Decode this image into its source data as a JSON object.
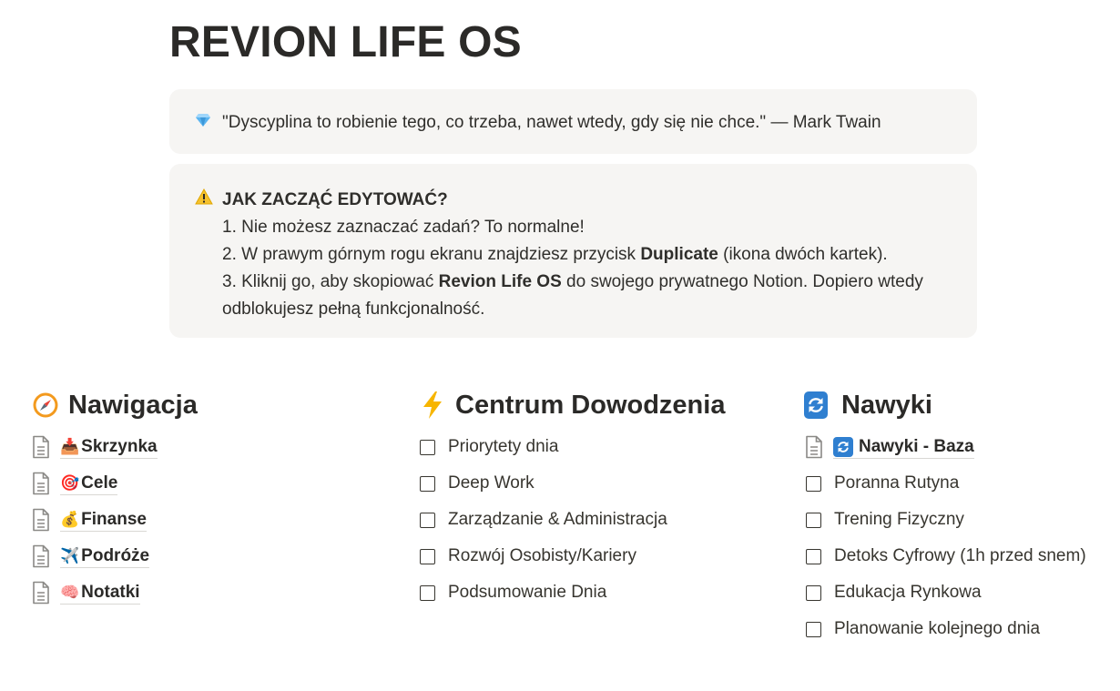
{
  "page": {
    "title": "REVION LIFE OS"
  },
  "quote_callout": {
    "icon": "gem-icon",
    "text": "\"Dyscyplina to robienie tego, co trzeba, nawet wtedy, gdy się nie chce.\" — Mark Twain"
  },
  "warning_callout": {
    "icon": "warning-icon",
    "title": "JAK ZACZĄĆ EDYTOWAĆ?",
    "line1": "1. Nie możesz zaznaczać zadań? To normalne!",
    "line2_a": "2. W prawym górnym rogu ekranu znajdziesz przycisk ",
    "line2_b": "Duplicate",
    "line2_c": " (ikona dwóch kartek).",
    "line3_a": "3. Kliknij go, aby skopiować ",
    "line3_b": "Revion Life OS",
    "line3_c": " do swojego prywatnego Notion. Dopiero wtedy odblokujesz pełną funkcjonalność."
  },
  "navigation": {
    "icon": "compass-icon",
    "title": "Nawigacja",
    "items": [
      {
        "emoji": "📥",
        "label": "Skrzynka"
      },
      {
        "emoji": "🎯",
        "label": "Cele"
      },
      {
        "emoji": "💰",
        "label": "Finanse"
      },
      {
        "emoji": "✈️",
        "label": "Podróże"
      },
      {
        "emoji": "🧠",
        "label": "Notatki"
      }
    ]
  },
  "command_center": {
    "icon": "lightning-icon",
    "title": "Centrum Dowodzenia",
    "tasks": [
      {
        "label": "Priorytety dnia",
        "checked": false
      },
      {
        "label": "Deep Work",
        "checked": false
      },
      {
        "label": "Zarządzanie & Administracja",
        "checked": false
      },
      {
        "label": "Rozwój Osobisty/Kariery",
        "checked": false
      },
      {
        "label": "Podsumowanie Dnia",
        "checked": false
      }
    ]
  },
  "habits": {
    "icon": "sync-icon",
    "title": "Nawyki",
    "db_link": {
      "label": "Nawyki - Baza"
    },
    "tasks": [
      {
        "label": "Poranna Rutyna",
        "checked": false
      },
      {
        "label": "Trening Fizyczny",
        "checked": false
      },
      {
        "label": "Detoks Cyfrowy (1h przed snem)",
        "checked": false
      },
      {
        "label": "Edukacja Rynkowa",
        "checked": false
      },
      {
        "label": "Planowanie kolejnego dnia",
        "checked": false
      }
    ]
  },
  "colors": {
    "callout_bg": "#f6f5f3",
    "text": "#37352f",
    "sync_blue": "#2f7fd0"
  }
}
